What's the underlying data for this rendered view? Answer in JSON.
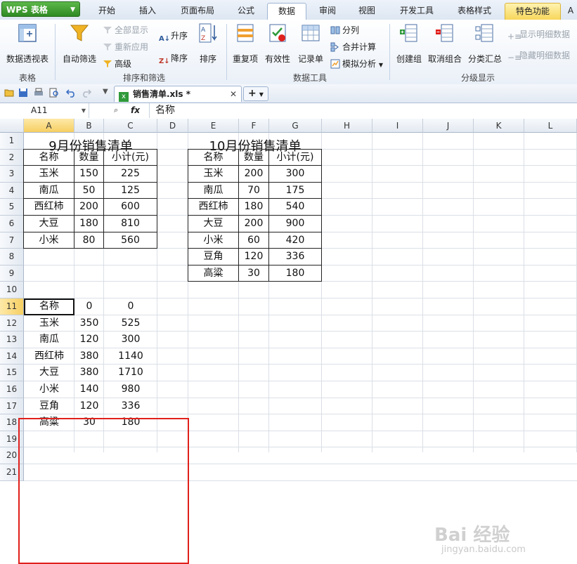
{
  "app": {
    "name": "WPS 表格"
  },
  "menu_tabs": [
    "开始",
    "插入",
    "页面布局",
    "公式",
    "数据",
    "审阅",
    "视图",
    "开发工具",
    "表格样式",
    "特色功能",
    "A"
  ],
  "active_tab": "数据",
  "ribbon": {
    "groups": {
      "table": "表格",
      "sort_filter": "排序和筛选",
      "data_tools": "数据工具",
      "outline": "分级显示"
    },
    "buttons": {
      "pivot": "数据透视表",
      "auto_filter": "自动筛选",
      "show_all": "全部显示",
      "reapply": "重新应用",
      "advanced": "高级",
      "sort_asc": "升序",
      "sort_desc": "降序",
      "sort": "排序",
      "duplicates": "重复项",
      "validity": "有效性",
      "record_list": "记录单",
      "split_column": "分列",
      "consolidate": "合并计算",
      "what_if": "模拟分析",
      "group": "创建组",
      "ungroup": "取消组合",
      "subtotal": "分类汇总",
      "show_detail": "显示明细数据",
      "hide_detail": "隐藏明细数据"
    }
  },
  "document": {
    "tab_label": "销售清单.xls *"
  },
  "formula_bar": {
    "name_box": "A11",
    "fx_label": "fx",
    "content": "名称"
  },
  "columns": [
    "A",
    "B",
    "C",
    "D",
    "E",
    "F",
    "G",
    "H",
    "I",
    "J",
    "K",
    "L"
  ],
  "rows": [
    "1",
    "2",
    "3",
    "4",
    "5",
    "6",
    "7",
    "8",
    "9",
    "10",
    "11",
    "12",
    "13",
    "14",
    "15",
    "16",
    "17",
    "18",
    "19",
    "20",
    "21"
  ],
  "sheet": {
    "sept_title": "9月份销售清单",
    "oct_title": "10月份销售清单",
    "headers": [
      "名称",
      "数量",
      "小计(元)"
    ],
    "sept_rows": [
      [
        "玉米",
        "150",
        "225"
      ],
      [
        "南瓜",
        "50",
        "125"
      ],
      [
        "西红柿",
        "200",
        "600"
      ],
      [
        "大豆",
        "180",
        "810"
      ],
      [
        "小米",
        "80",
        "560"
      ]
    ],
    "oct_rows": [
      [
        "玉米",
        "200",
        "300"
      ],
      [
        "南瓜",
        "70",
        "175"
      ],
      [
        "西红柿",
        "180",
        "540"
      ],
      [
        "大豆",
        "200",
        "900"
      ],
      [
        "小米",
        "60",
        "420"
      ],
      [
        "豆角",
        "120",
        "336"
      ],
      [
        "高粱",
        "30",
        "180"
      ]
    ],
    "consolidated_header": [
      "名称",
      "0",
      "0"
    ],
    "consolidated_rows": [
      [
        "玉米",
        "350",
        "525"
      ],
      [
        "南瓜",
        "120",
        "300"
      ],
      [
        "西红柿",
        "380",
        "1140"
      ],
      [
        "大豆",
        "380",
        "1710"
      ],
      [
        "小米",
        "140",
        "980"
      ],
      [
        "豆角",
        "120",
        "336"
      ],
      [
        "高粱",
        "30",
        "180"
      ]
    ]
  },
  "watermark": {
    "main": "Bai 经验",
    "sub": "jingyan.baidu.com"
  }
}
